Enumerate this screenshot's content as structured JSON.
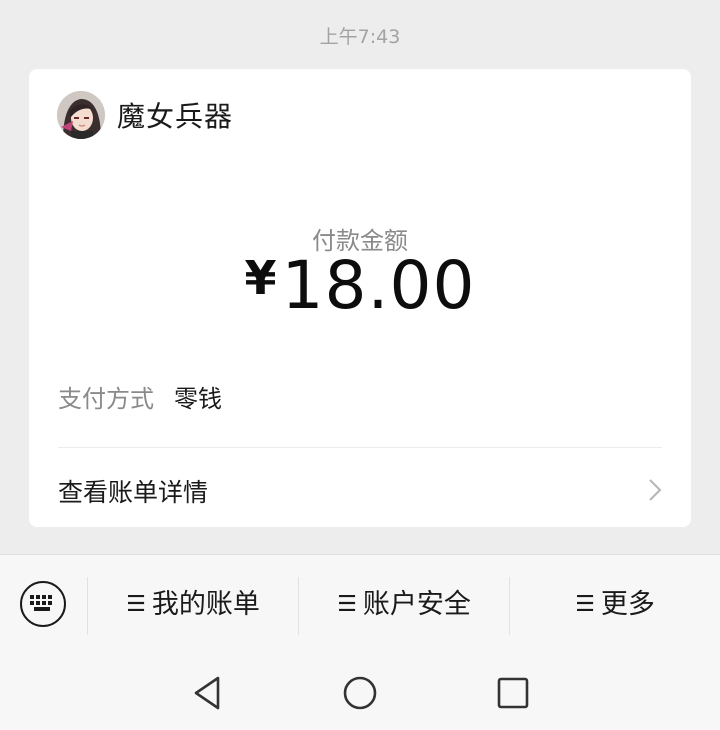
{
  "timestamp": "上午7:43",
  "merchant": {
    "name": "魔女兵器",
    "avatar_icon": "anime-girl-avatar"
  },
  "amount": {
    "label": "付款金额",
    "currency_symbol": "¥",
    "value": "18.00"
  },
  "payment_method": {
    "label": "支付方式",
    "value": "零钱"
  },
  "bill_details": {
    "label": "查看账单详情",
    "icon": "chevron-right-icon"
  },
  "menu": {
    "keyboard_icon": "keyboard-icon",
    "items": [
      {
        "label": "我的账单",
        "icon": "menu-icon"
      },
      {
        "label": "账户安全",
        "icon": "menu-icon"
      },
      {
        "label": "更多",
        "icon": "menu-icon"
      }
    ]
  },
  "nav": {
    "back_icon": "triangle-back-icon",
    "home_icon": "circle-home-icon",
    "recents_icon": "square-recents-icon"
  },
  "colors": {
    "background": "#ededed",
    "card": "#ffffff",
    "muted_text": "#8a8a8a",
    "primary_text": "#1a1a1a"
  }
}
